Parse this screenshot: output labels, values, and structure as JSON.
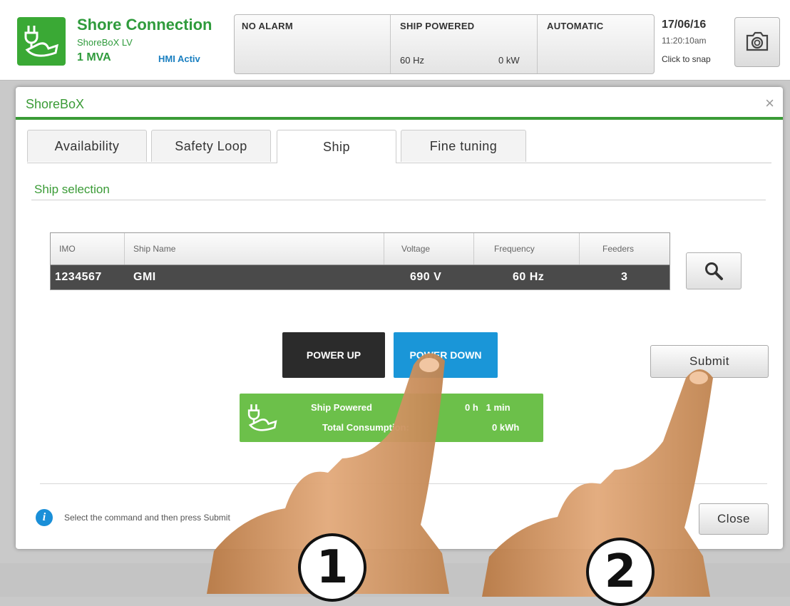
{
  "header": {
    "title": "Shore Connection",
    "subtitle": "ShoreBoX LV",
    "rating": "1 MVA",
    "hmi": "HMI Activ",
    "alarm": "NO ALARM",
    "ship_status": "SHIP POWERED",
    "frequency": "60 Hz",
    "power": "0 kW",
    "mode": "AUTOMATIC",
    "date": "17/06/16",
    "time": "11:20:10am",
    "snap_hint": "Click to snap",
    "brand_color": "#3aa935"
  },
  "modal": {
    "title": "ShoreBoX",
    "close_glyph": "×",
    "tabs": [
      {
        "label": "Availability"
      },
      {
        "label": "Safety Loop"
      },
      {
        "label": "Ship",
        "active": true
      },
      {
        "label": "Fine tuning"
      }
    ],
    "section": "Ship selection",
    "table": {
      "headers": [
        "IMO",
        "Ship Name",
        "Voltage",
        "Frequency",
        "Feeders"
      ],
      "rows": [
        [
          "1234567",
          "GMI",
          "690 V",
          "60 Hz",
          "3"
        ]
      ]
    },
    "power_up": "POWER UP",
    "power_down": "POWER DOWN",
    "submit": "Submit",
    "status_card": {
      "powered_label": "Ship Powered",
      "powered_value": "0 h   1 min",
      "consumption_label": "Total Consumption:",
      "consumption_value": "0 kWh"
    },
    "info_text": "Select the command and then press Submit",
    "close": "Close",
    "accent": "#3a9b36",
    "power_down_color": "#1a96d8"
  },
  "overlay": {
    "step1": "1",
    "step2": "2"
  }
}
